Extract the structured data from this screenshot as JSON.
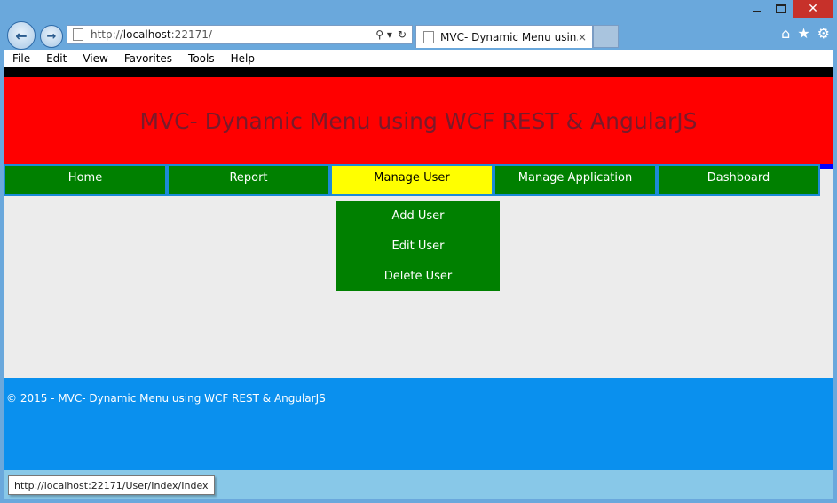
{
  "browser": {
    "address_prefix": "http://",
    "address_host": "localhost",
    "address_rest": ":22171/",
    "tab_title": "MVC- Dynamic Menu usin...",
    "tab_close": "×",
    "search_glyph": "⚲ ▾",
    "refresh_glyph": "↻",
    "back_glyph": "←",
    "forward_glyph": "→",
    "home_glyph": "⌂",
    "star_glyph": "★",
    "gear_glyph": "⚙"
  },
  "window": {
    "close_glyph": "✕"
  },
  "menubar": {
    "file": "File",
    "edit": "Edit",
    "view": "View",
    "favorites": "Favorites",
    "tools": "Tools",
    "help": "Help"
  },
  "page": {
    "header_title": "MVC- Dynamic Menu using WCF REST & AngularJS",
    "menu": [
      "Home",
      "Report",
      "Manage User",
      "Manage Application",
      "Dashboard"
    ],
    "active_menu": "Manage User",
    "submenu": [
      "Add User",
      "Edit User",
      "Delete User"
    ],
    "footer": "© 2015 - MVC- Dynamic Menu using WCF REST & AngularJS"
  },
  "status": {
    "url": "http://localhost:22171/User/Index/Index"
  },
  "colors": {
    "header_bg": "#ff0000",
    "menu_bg": "#008000",
    "menu_active_bg": "#ffff00",
    "footer_bg": "#0a90ee",
    "content_bg": "#ececec"
  }
}
